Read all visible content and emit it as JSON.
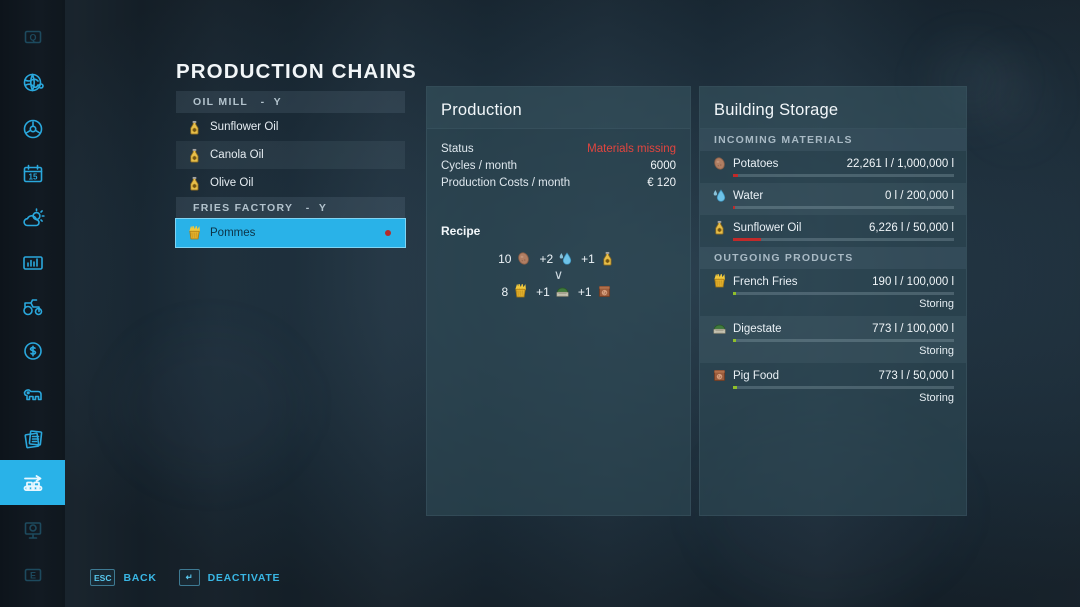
{
  "sidebar": {
    "items": [
      {
        "name": "help-key-q",
        "icon": "key-q-icon",
        "selected": false,
        "dim": true
      },
      {
        "name": "map-globe",
        "icon": "globe-icon",
        "selected": false,
        "dim": false
      },
      {
        "name": "vehicles-steering",
        "icon": "steering-wheel-icon",
        "selected": false,
        "dim": false
      },
      {
        "name": "calendar",
        "icon": "calendar-15-icon",
        "selected": false,
        "dim": false
      },
      {
        "name": "weather",
        "icon": "weather-sun-cloud-icon",
        "selected": false,
        "dim": false
      },
      {
        "name": "statistics",
        "icon": "bar-chart-icon",
        "selected": false,
        "dim": false
      },
      {
        "name": "vehicles",
        "icon": "tractor-icon",
        "selected": false,
        "dim": false
      },
      {
        "name": "finances",
        "icon": "dollar-coin-icon",
        "selected": false,
        "dim": false
      },
      {
        "name": "animals",
        "icon": "cow-icon",
        "selected": false,
        "dim": false
      },
      {
        "name": "contracts",
        "icon": "documents-icon",
        "selected": false,
        "dim": false
      },
      {
        "name": "production-chains",
        "icon": "conveyor-belt-icon",
        "selected": true,
        "dim": false
      },
      {
        "name": "construction",
        "icon": "billboard-tree-icon",
        "selected": false,
        "dim": true
      },
      {
        "name": "help-key-e",
        "icon": "key-e-icon",
        "selected": false,
        "dim": true
      }
    ]
  },
  "page": {
    "title": "PRODUCTION CHAINS"
  },
  "chain_list": [
    {
      "type": "group",
      "label": "OIL MILL   -  Y"
    },
    {
      "type": "item",
      "label": "Sunflower Oil",
      "icon": "oil-bottle-icon",
      "alt": false,
      "selected": false,
      "status": null
    },
    {
      "type": "item",
      "label": "Canola Oil",
      "icon": "oil-bottle-icon",
      "alt": true,
      "selected": false,
      "status": null
    },
    {
      "type": "item",
      "label": "Olive Oil",
      "icon": "oil-bottle-icon",
      "alt": false,
      "selected": false,
      "status": null
    },
    {
      "type": "group",
      "label": "FRIES FACTORY   -  Y"
    },
    {
      "type": "item",
      "label": "Pommes",
      "icon": "french-fries-icon",
      "alt": false,
      "selected": true,
      "status": "red"
    }
  ],
  "production": {
    "title": "Production",
    "rows": [
      {
        "label": "Status",
        "value": "Materials missing",
        "alert": true
      },
      {
        "label": "Cycles / month",
        "value": "6000",
        "alert": false
      },
      {
        "label": "Production Costs / month",
        "value": "€ 120",
        "alert": false
      }
    ],
    "recipe_label": "Recipe",
    "recipe": {
      "inputs": [
        {
          "amount": "10",
          "icon": "potato-icon",
          "name": "Potatoes"
        },
        {
          "amount": "+2",
          "icon": "water-drop-icon",
          "name": "Water"
        },
        {
          "amount": "+1",
          "icon": "oil-bottle-icon",
          "name": "Sunflower Oil"
        }
      ],
      "arrow": "∨",
      "outputs": [
        {
          "amount": "8",
          "icon": "french-fries-icon",
          "name": "French Fries"
        },
        {
          "amount": "+1",
          "icon": "digestate-icon",
          "name": "Digestate"
        },
        {
          "amount": "+1",
          "icon": "pig-food-icon",
          "name": "Pig Food"
        }
      ]
    }
  },
  "storage": {
    "title": "Building Storage",
    "sections": [
      {
        "header": "INCOMING MATERIALS",
        "rows": [
          {
            "name": "Potatoes",
            "icon": "potato-icon",
            "amount": "22,261 l / 1,000,000 l",
            "fill_pct": 2.2,
            "bar": "low",
            "state": null,
            "alt": false
          },
          {
            "name": "Water",
            "icon": "water-drop-icon",
            "amount": "0 l / 200,000 l",
            "fill_pct": 1.0,
            "bar": "low",
            "state": null,
            "alt": true
          },
          {
            "name": "Sunflower Oil",
            "icon": "oil-bottle-icon",
            "amount": "6,226 l / 50,000 l",
            "fill_pct": 12.5,
            "bar": "low",
            "state": null,
            "alt": false
          }
        ]
      },
      {
        "header": "OUTGOING PRODUCTS",
        "rows": [
          {
            "name": "French Fries",
            "icon": "french-fries-icon",
            "amount": "190 l / 100,000 l",
            "fill_pct": 1.2,
            "bar": "ok",
            "state": "Storing",
            "alt": false
          },
          {
            "name": "Digestate",
            "icon": "digestate-icon",
            "amount": "773 l / 100,000 l",
            "fill_pct": 1.5,
            "bar": "ok",
            "state": "Storing",
            "alt": true
          },
          {
            "name": "Pig Food",
            "icon": "pig-food-icon",
            "amount": "773 l / 50,000 l",
            "fill_pct": 2.0,
            "bar": "ok",
            "state": "Storing",
            "alt": false
          }
        ]
      }
    ]
  },
  "bottom_bar": {
    "hints": [
      {
        "key": "ESC",
        "key_icon": "esc-key-icon",
        "label": "BACK"
      },
      {
        "key": "↵",
        "key_icon": "enter-key-icon",
        "label": "DEACTIVATE"
      }
    ]
  },
  "colors": {
    "accent": "#29b2e8",
    "alert_red": "#e2453f",
    "bar_low": "#c12a2a",
    "bar_ok": "#8fbf2a",
    "panel_bg": "#2e4a55",
    "text": "#eef4f8"
  }
}
